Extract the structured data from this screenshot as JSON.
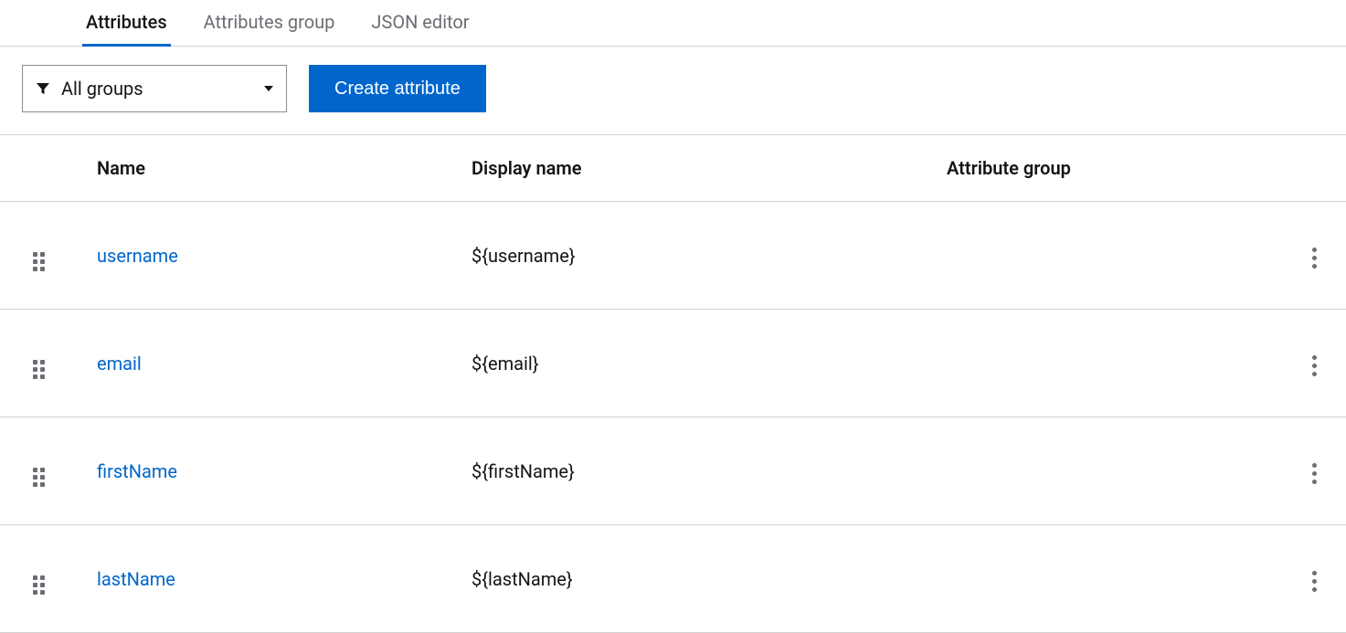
{
  "tabs": [
    {
      "label": "Attributes",
      "active": true
    },
    {
      "label": "Attributes group",
      "active": false
    },
    {
      "label": "JSON editor",
      "active": false
    }
  ],
  "toolbar": {
    "filter_label": "All groups",
    "create_button": "Create attribute"
  },
  "table": {
    "headers": {
      "name": "Name",
      "display_name": "Display name",
      "attribute_group": "Attribute group"
    },
    "rows": [
      {
        "name": "username",
        "display_name": "${username}",
        "attribute_group": ""
      },
      {
        "name": "email",
        "display_name": "${email}",
        "attribute_group": ""
      },
      {
        "name": "firstName",
        "display_name": "${firstName}",
        "attribute_group": ""
      },
      {
        "name": "lastName",
        "display_name": "${lastName}",
        "attribute_group": ""
      }
    ]
  }
}
